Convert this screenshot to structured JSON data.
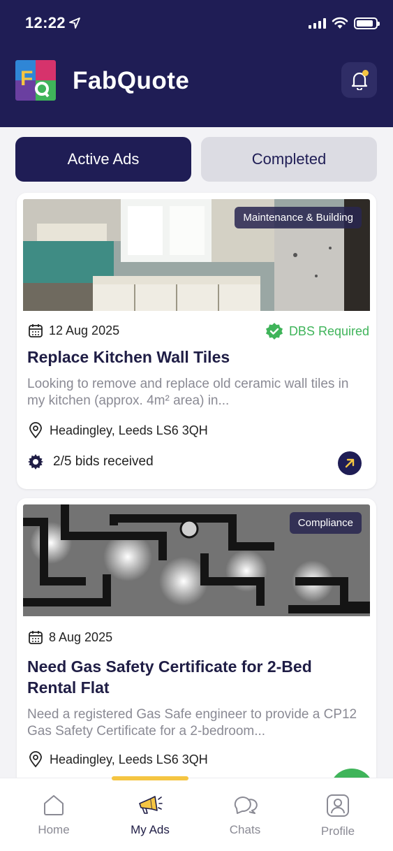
{
  "status_bar": {
    "time": "12:22",
    "battery_level": 0.9
  },
  "header": {
    "brand": "FabQuote"
  },
  "tabs": [
    {
      "label": "Active Ads",
      "active": true
    },
    {
      "label": "Completed",
      "active": false
    }
  ],
  "ads": [
    {
      "category": "Maintenance & Building",
      "date": "12 Aug 2025",
      "badge": "DBS Required",
      "title": "Replace Kitchen Wall Tiles",
      "description": "Looking to remove and replace old ceramic wall tiles in my kitchen (approx. 4m² area) in...",
      "location": "Headingley, Leeds LS6 3QH",
      "bids": "2/5 bids received"
    },
    {
      "category": "Compliance",
      "date": "8 Aug 2025",
      "title": "Need Gas Safety Certificate for 2-Bed Rental Flat",
      "description": "Need a registered Gas Safe engineer to provide a CP12 Gas Safety Certificate for a 2-bedroom...",
      "location": "Headingley, Leeds LS6 3QH"
    }
  ],
  "bottom_nav": [
    {
      "label": "Home",
      "icon": "home-icon",
      "active": false
    },
    {
      "label": "My Ads",
      "icon": "megaphone-icon",
      "active": true
    },
    {
      "label": "Chats",
      "icon": "chat-icon",
      "active": false
    },
    {
      "label": "Profile",
      "icon": "profile-icon",
      "active": false
    }
  ],
  "colors": {
    "primary": "#1f1d55",
    "accent": "#f5c542",
    "success": "#3fb45a"
  }
}
